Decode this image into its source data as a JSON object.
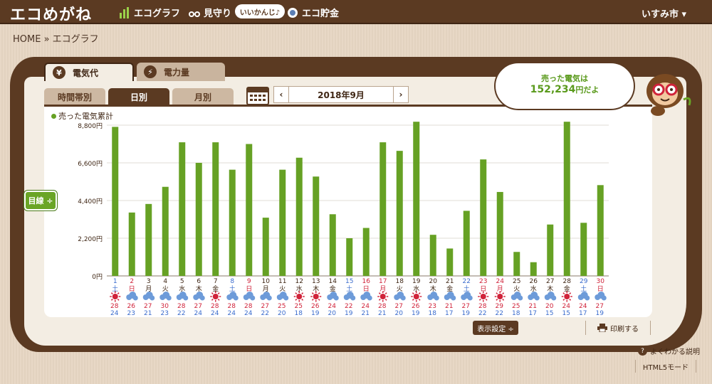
{
  "header": {
    "logo": "エコめがね",
    "nav": [
      "エコグラフ",
      "見守り",
      "エコ貯金"
    ],
    "bubble": "いいかんじ♪",
    "city": "いすみ市 ▾"
  },
  "breadcrumb": "HOME » エコグラフ",
  "tabs": {
    "main": [
      "電気代",
      "電力量"
    ],
    "sub": [
      "時間帯別",
      "日別",
      "月別"
    ]
  },
  "period": {
    "prev": "‹",
    "label": "2018年9月",
    "next": "›"
  },
  "sold": {
    "line1": "売った電気は",
    "amount": "152,234",
    "unit": "円だよ"
  },
  "target_button": "目線 ÷",
  "footer": {
    "display_settings": "表示設定 ÷",
    "print": "印刷する",
    "help": "よくわかる説明",
    "html5": "HTML5モード"
  },
  "colors": {
    "brown": "#5b3a22",
    "bar": "#66a124",
    "red": "#d0233a",
    "blue": "#3b6ccd"
  },
  "chart_data": {
    "type": "bar",
    "legend": "売った電気累計",
    "ylim": [
      0,
      8800
    ],
    "yticks": [
      "0円",
      "2,200円",
      "4,400円",
      "6,600円",
      "8,800円"
    ],
    "days": [
      "1",
      "2",
      "3",
      "4",
      "5",
      "6",
      "7",
      "8",
      "9",
      "10",
      "11",
      "12",
      "13",
      "14",
      "15",
      "16",
      "17",
      "18",
      "19",
      "20",
      "21",
      "22",
      "23",
      "24",
      "25",
      "26",
      "27",
      "28",
      "29",
      "30"
    ],
    "weekday": [
      "土",
      "日",
      "月",
      "火",
      "水",
      "木",
      "金",
      "土",
      "日",
      "月",
      "火",
      "水",
      "木",
      "金",
      "土",
      "日",
      "月",
      "火",
      "水",
      "木",
      "金",
      "土",
      "日",
      "月",
      "火",
      "水",
      "木",
      "金",
      "土",
      "日"
    ],
    "day_color": [
      "blue",
      "red",
      "black",
      "black",
      "black",
      "black",
      "black",
      "blue",
      "red",
      "black",
      "black",
      "black",
      "black",
      "black",
      "blue",
      "red",
      "red",
      "black",
      "black",
      "black",
      "black",
      "blue",
      "red",
      "red",
      "black",
      "black",
      "black",
      "black",
      "blue",
      "red"
    ],
    "values": [
      8700,
      3700,
      4200,
      5200,
      7800,
      6600,
      7800,
      6200,
      7700,
      3400,
      6200,
      6900,
      5800,
      3600,
      2200,
      2800,
      7800,
      7300,
      9000,
      2400,
      1600,
      3800,
      6800,
      4900,
      1400,
      800,
      3000,
      9000,
      3100,
      5300
    ],
    "weather": [
      "sun",
      "cloud",
      "cloud",
      "cloud",
      "cloud",
      "cloud",
      "sun",
      "cloud",
      "cloud",
      "cloud",
      "cloud",
      "sun",
      "sun",
      "cloud",
      "cloud",
      "cloud",
      "sun",
      "cloud",
      "sun",
      "cloud",
      "cloud",
      "cloud",
      "sun",
      "sun",
      "cloud",
      "cloud",
      "cloud",
      "sun",
      "cloud",
      "cloud"
    ],
    "high": [
      "28",
      "26",
      "27",
      "30",
      "28",
      "27",
      "28",
      "28",
      "28",
      "27",
      "25",
      "25",
      "26",
      "24",
      "22",
      "24",
      "28",
      "27",
      "26",
      "23",
      "21",
      "27",
      "28",
      "29",
      "25",
      "21",
      "20",
      "24",
      "24",
      "27"
    ],
    "low": [
      "24",
      "23",
      "21",
      "23",
      "22",
      "24",
      "24",
      "24",
      "24",
      "22",
      "20",
      "18",
      "19",
      "20",
      "19",
      "21",
      "21",
      "20",
      "19",
      "18",
      "17",
      "19",
      "22",
      "22",
      "18",
      "17",
      "15",
      "15",
      "17",
      "19"
    ]
  }
}
